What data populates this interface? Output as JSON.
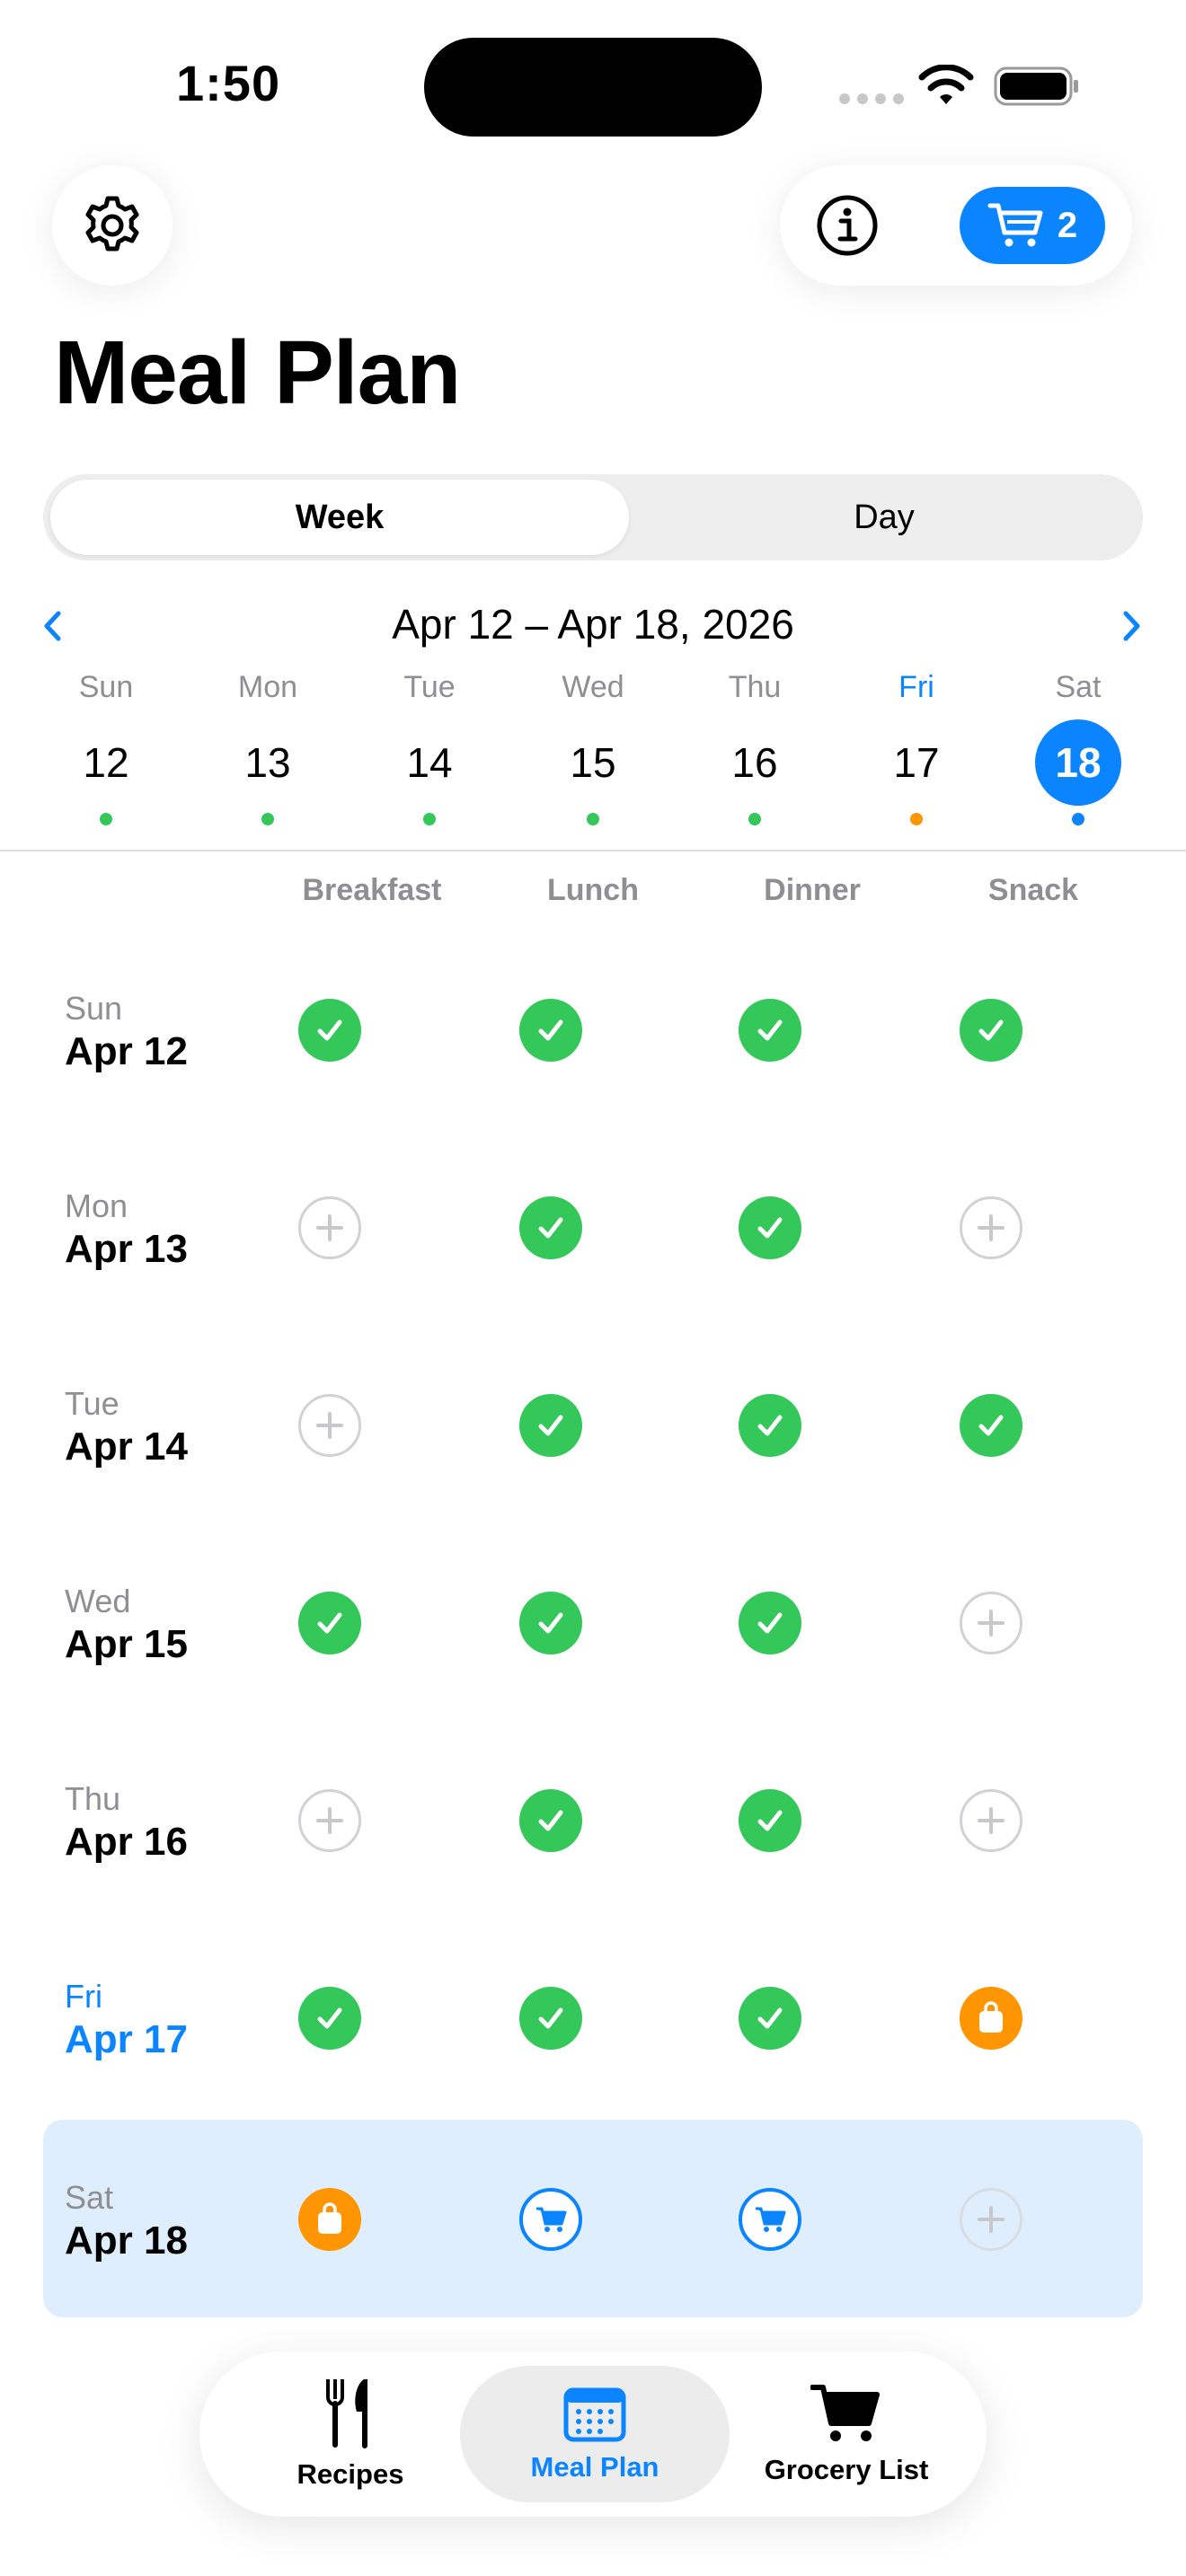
{
  "status_bar": {
    "time": "1:50"
  },
  "header": {
    "settings_icon": "gear-icon",
    "info_icon": "info-icon",
    "cart_icon": "cart-icon",
    "cart_count": "2",
    "title": "Meal Plan"
  },
  "view_toggle": {
    "week_label": "Week",
    "day_label": "Day",
    "selected": "Week"
  },
  "week_nav": {
    "range": "Apr 12 – Apr 18, 2026",
    "days": [
      {
        "abbr": "Sun",
        "num": "12",
        "dot": "#34c759"
      },
      {
        "abbr": "Mon",
        "num": "13",
        "dot": "#34c759"
      },
      {
        "abbr": "Tue",
        "num": "14",
        "dot": "#34c759"
      },
      {
        "abbr": "Wed",
        "num": "15",
        "dot": "#34c759"
      },
      {
        "abbr": "Thu",
        "num": "16",
        "dot": "#34c759"
      },
      {
        "abbr": "Fri",
        "num": "17",
        "dot": "#ff9500"
      },
      {
        "abbr": "Sat",
        "num": "18",
        "dot": "#0a84ff"
      }
    ]
  },
  "meal_headers": [
    "Breakfast",
    "Lunch",
    "Dinner",
    "Snack"
  ],
  "rows": [
    {
      "day": "Sun",
      "date": "Apr 12",
      "slots": [
        "done",
        "done",
        "done",
        "done"
      ]
    },
    {
      "day": "Mon",
      "date": "Apr 13",
      "slots": [
        "empty",
        "done",
        "done",
        "empty"
      ]
    },
    {
      "day": "Tue",
      "date": "Apr 14",
      "slots": [
        "empty",
        "done",
        "done",
        "done"
      ]
    },
    {
      "day": "Wed",
      "date": "Apr 15",
      "slots": [
        "done",
        "done",
        "done",
        "empty"
      ]
    },
    {
      "day": "Thu",
      "date": "Apr 16",
      "slots": [
        "empty",
        "done",
        "done",
        "empty"
      ]
    },
    {
      "day": "Fri",
      "date": "Apr 17",
      "slots": [
        "done",
        "done",
        "done",
        "pending"
      ]
    },
    {
      "day": "Sat",
      "date": "Apr 18",
      "slots": [
        "pending",
        "cart",
        "cart",
        "empty"
      ]
    }
  ],
  "tab_bar": {
    "items": [
      {
        "label": "Recipes",
        "icon": "fork-knife-icon"
      },
      {
        "label": "Meal Plan",
        "icon": "calendar-icon"
      },
      {
        "label": "Grocery List",
        "icon": "cart-icon"
      }
    ],
    "selected": "Meal Plan"
  },
  "colors": {
    "accent": "#0a84ff",
    "done": "#34c759",
    "pending": "#ff9500",
    "highlight": "#dfeefc"
  }
}
